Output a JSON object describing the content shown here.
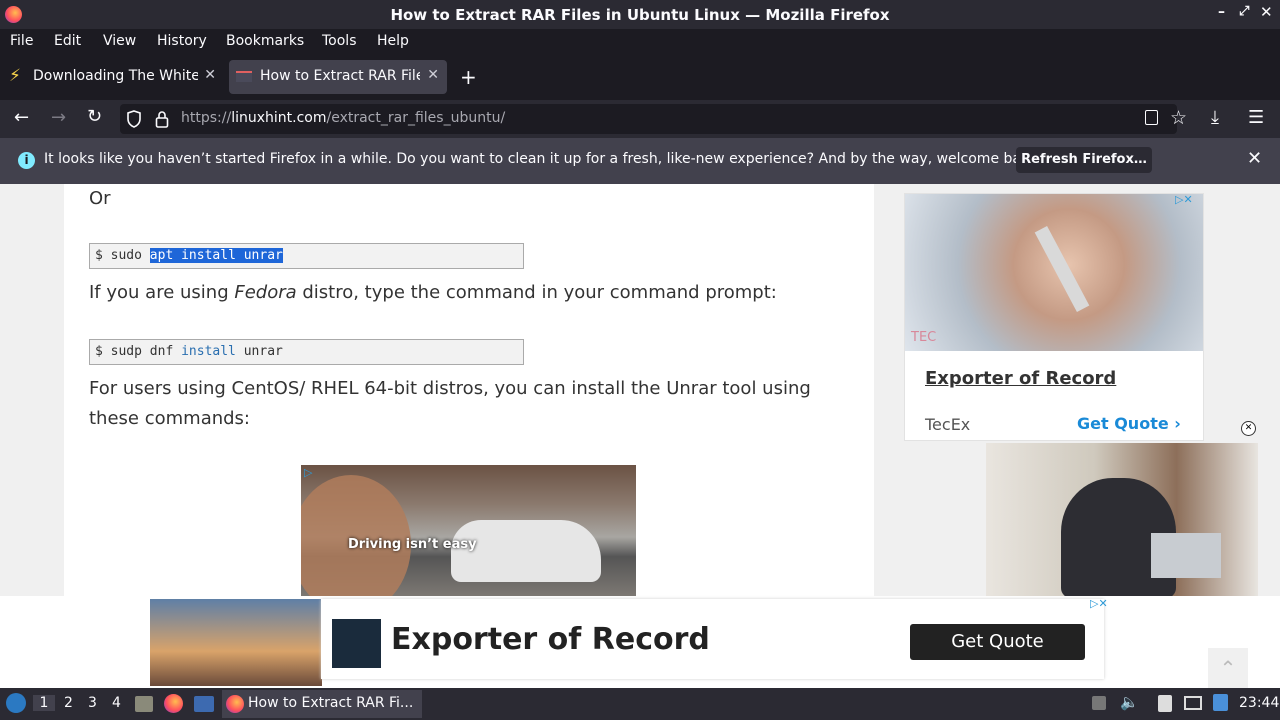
{
  "window": {
    "title": "How to Extract RAR Files in Ubuntu Linux — Mozilla Firefox"
  },
  "menu": [
    "File",
    "Edit",
    "View",
    "History",
    "Bookmarks",
    "Tools",
    "Help"
  ],
  "tabs": [
    {
      "label": "Downloading The White House, Ray Strachey"
    },
    {
      "label": "How to Extract RAR Files in Ubuntu Linux"
    }
  ],
  "url": {
    "prefix": "https://",
    "domain": "linuxhint.com",
    "path": "/extract_rar_files_ubuntu/"
  },
  "notification": {
    "text": "It looks like you haven’t started Firefox in a while. Do you want to clean it up for a fresh, like-new experience? And by the way, welcome back!",
    "button": "Refresh Firefox…"
  },
  "article": {
    "or": "Or",
    "code1": {
      "prompt": "$ sudo ",
      "selected": "apt install unrar"
    },
    "fedora": {
      "before": "If you are using ",
      "italic": "Fedora",
      "after": " distro, type the command in your command prompt:"
    },
    "code2": {
      "prompt": "$ sudp dnf ",
      "kw": "install",
      "rest": " unrar"
    },
    "centos_line1": "For users using CentOS/ RHEL 64-bit distros, you can install the Unrar tool using",
    "centos_line2": "these commands:"
  },
  "ad_inline": {
    "caption": "Driving isn’t easy"
  },
  "ad_side": {
    "title": "Exporter of Record",
    "brand": "TecEx",
    "cta": "Get Quote",
    "logo": "TEC"
  },
  "ad_bottom": {
    "title": "Exporter of Record",
    "cta": "Get Quote"
  },
  "taskbar": {
    "workspaces": [
      "1",
      "2",
      "3",
      "4"
    ],
    "window_label": "How to Extract RAR Fi...",
    "clock": "23:44"
  }
}
